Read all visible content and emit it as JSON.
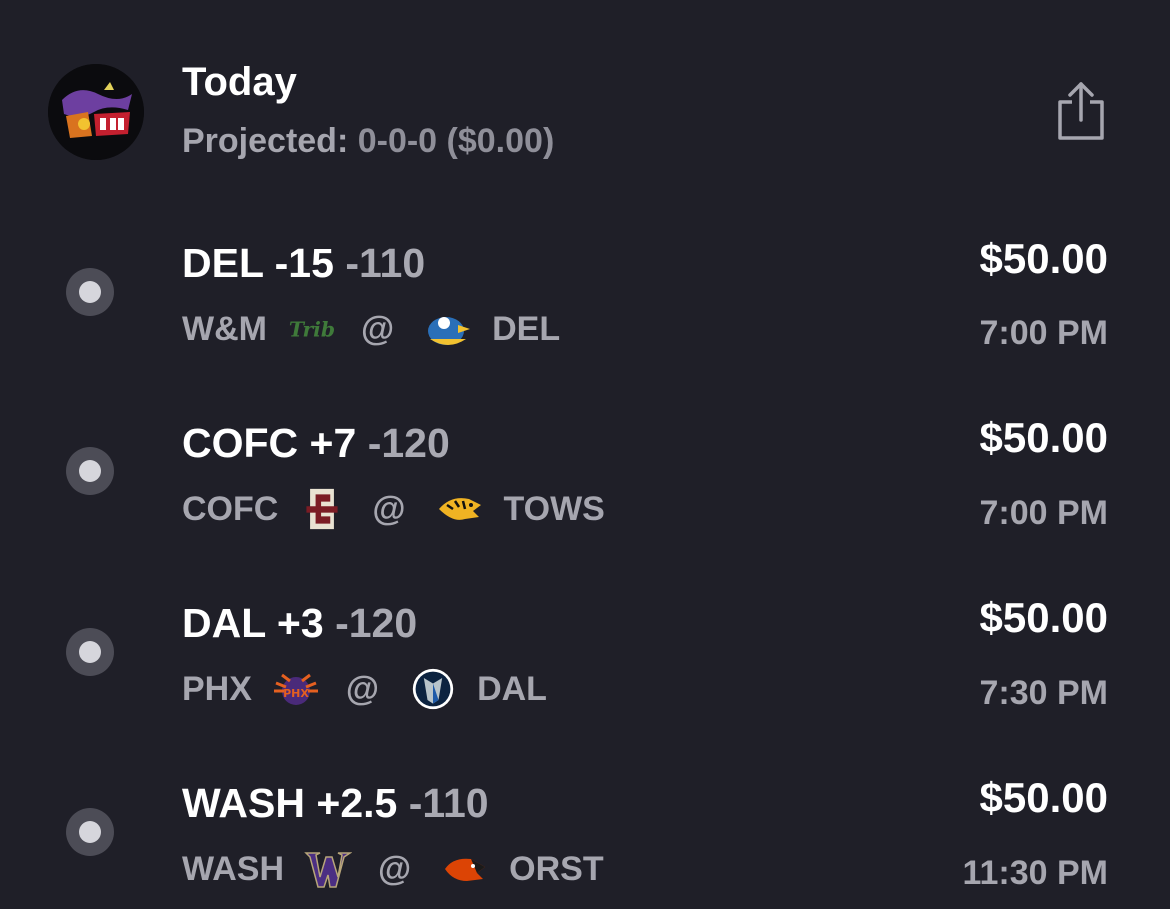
{
  "header": {
    "title": "Today",
    "projected_label": "Projected:",
    "projected_value": "0-0-0 ($0.00)",
    "share_icon": "share-icon"
  },
  "bets": [
    {
      "pick_team": "DEL -15",
      "pick_odds": "-110",
      "amount": "$50.00",
      "away": "W&M",
      "away_logo": "william-and-mary-tribe-logo",
      "at": "@",
      "home": "DEL",
      "home_logo": "delaware-blue-hen-logo",
      "time": "7:00 PM"
    },
    {
      "pick_team": "COFC +7",
      "pick_odds": "-120",
      "amount": "$50.00",
      "away": "COFC",
      "away_logo": "charleston-logo",
      "at": "@",
      "home": "TOWS",
      "home_logo": "towson-tiger-logo",
      "time": "7:00 PM"
    },
    {
      "pick_team": "DAL +3",
      "pick_odds": "-120",
      "amount": "$50.00",
      "away": "PHX",
      "away_logo": "phoenix-suns-logo",
      "at": "@",
      "home": "DAL",
      "home_logo": "dallas-mavericks-logo",
      "time": "7:30 PM"
    },
    {
      "pick_team": "WASH +2.5",
      "pick_odds": "-110",
      "amount": "$50.00",
      "away": "WASH",
      "away_logo": "washington-huskies-logo",
      "at": "@",
      "home": "ORST",
      "home_logo": "oregon-state-beaver-logo",
      "time": "11:30 PM"
    }
  ],
  "colors": {
    "background": "#1f1f28",
    "primary_text": "#ffffff",
    "secondary_text": "#a6a6af"
  }
}
